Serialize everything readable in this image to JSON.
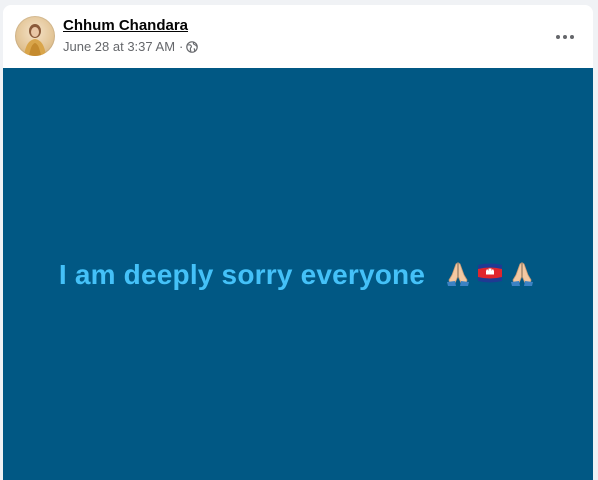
{
  "post": {
    "author": "Chhum Chandara",
    "timestamp": "June 28 at 3:37 AM",
    "separator": "·",
    "privacy_icon": "globe-icon",
    "menu_icon": "more-options-icon",
    "text": "I am deeply sorry everyone",
    "emojis": [
      "folded-hands-emoji",
      "cambodia-flag-emoji",
      "folded-hands-emoji"
    ],
    "colors": {
      "background": "#015884",
      "text": "#44c1f8"
    }
  }
}
